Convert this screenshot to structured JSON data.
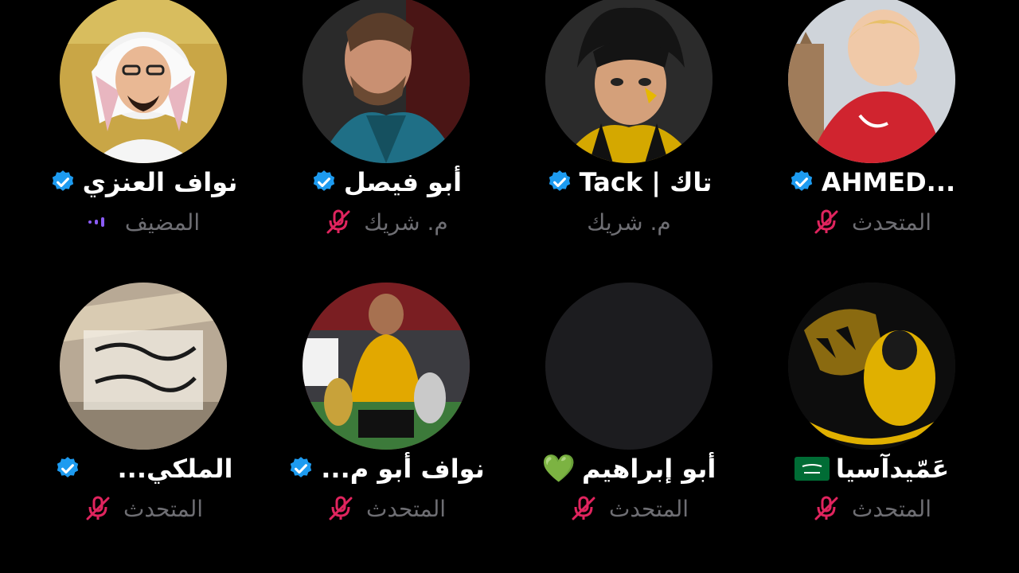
{
  "colors": {
    "background": "#000000",
    "verified": "#1d9bf0",
    "muted_mic": "#e0245e",
    "role_text": "#6e6e73",
    "host_dots": "#8b5cf6"
  },
  "participants": [
    {
      "name": "نواف العنزي",
      "role": "المضيف",
      "verified": true,
      "indicator": "host-dots-icon"
    },
    {
      "name": "أبو فيصل",
      "role": "م. شريك",
      "verified": true,
      "indicator": "muted-mic-icon"
    },
    {
      "name": "Tack | تاك",
      "role": "م. شريك",
      "verified": true,
      "indicator": "none"
    },
    {
      "name": "AHMED...",
      "role": "المتحدث",
      "verified": true,
      "indicator": "muted-mic-icon"
    },
    {
      "name": "الملكي...",
      "role": "المتحدث",
      "verified": true,
      "indicator": "muted-mic-icon"
    },
    {
      "name": "نواف أبو م...",
      "role": "المتحدث",
      "verified": true,
      "indicator": "muted-mic-icon"
    },
    {
      "name": "أبو إبراهيم",
      "role": "المتحدث",
      "verified": false,
      "indicator": "muted-mic-icon",
      "emoji": "💚"
    },
    {
      "name": "عَمّيدآسيا",
      "role": "المتحدث",
      "verified": false,
      "indicator": "muted-mic-icon",
      "flag": "saudi-flag-icon"
    }
  ]
}
